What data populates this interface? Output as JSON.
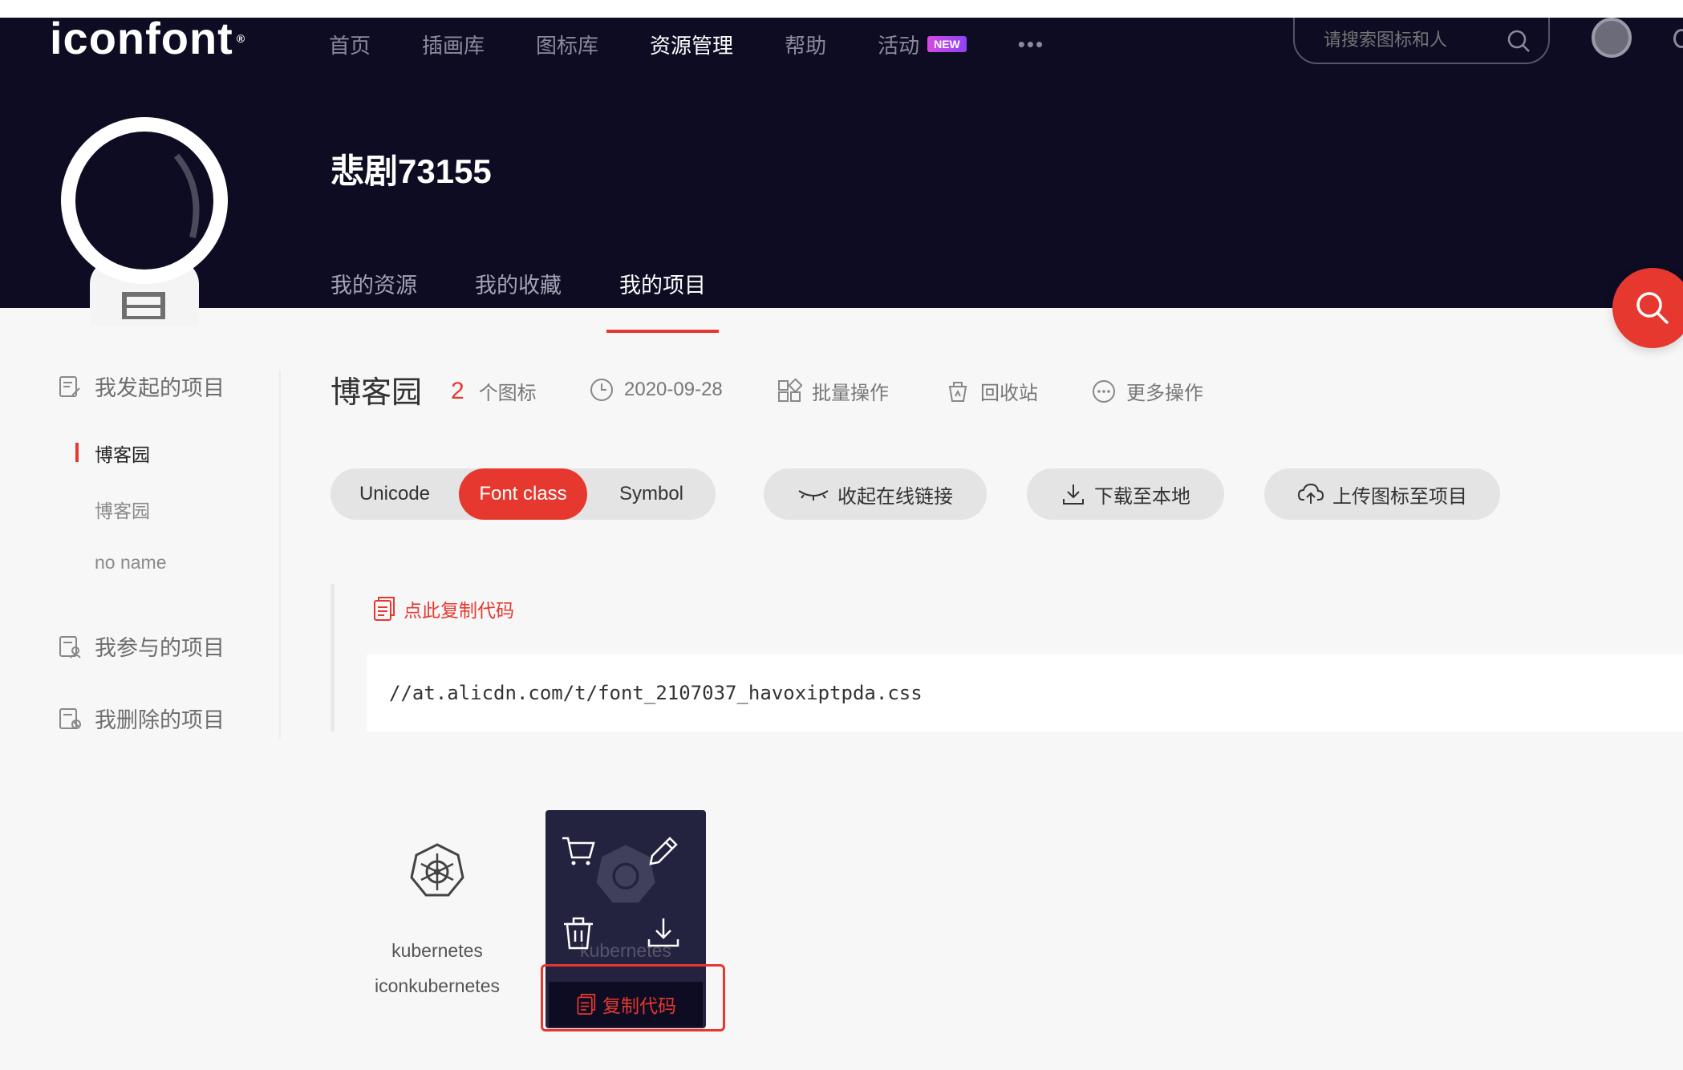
{
  "header": {
    "logo": "iconfont",
    "nav": [
      {
        "label": "首页"
      },
      {
        "label": "插画库"
      },
      {
        "label": "图标库"
      },
      {
        "label": "资源管理",
        "active": true
      },
      {
        "label": "帮助"
      },
      {
        "label": "活动",
        "badge": "NEW"
      }
    ],
    "more": "•••",
    "search_placeholder": "请搜索图标和人"
  },
  "profile": {
    "username": "悲剧73155",
    "tabs": [
      {
        "label": "我的资源"
      },
      {
        "label": "我的收藏"
      },
      {
        "label": "我的项目",
        "active": true
      }
    ]
  },
  "sidebar": {
    "groups": [
      {
        "label": "我发起的项目",
        "icon": "doc-edit-icon"
      },
      {
        "label": "我参与的项目",
        "icon": "doc-user-icon"
      },
      {
        "label": "我删除的项目",
        "icon": "doc-delete-icon"
      }
    ],
    "items": [
      {
        "label": "博客园",
        "active": true
      },
      {
        "label": "博客园"
      },
      {
        "label": "no name"
      }
    ]
  },
  "project": {
    "title": "博客园",
    "icon_count": "2",
    "icon_count_unit": "个图标",
    "date": "2020-09-28",
    "batch": "批量操作",
    "recycle": "回收站",
    "more": "更多操作",
    "format_tabs": [
      {
        "label": "Unicode"
      },
      {
        "label": "Font class",
        "active": true
      },
      {
        "label": "Symbol"
      }
    ],
    "collapse_link": "收起在线链接",
    "download": "下载至本地",
    "upload": "上传图标至项目",
    "copy_code_link": "点此复制代码",
    "css_url": "//at.alicdn.com/t/font_2107037_havoxiptpda.css"
  },
  "icons": [
    {
      "name": "kubernetes",
      "code": "iconkubernetes"
    },
    {
      "name": "kubernetes",
      "copy_label": "复制代码"
    }
  ],
  "colors": {
    "accent": "#e6382f",
    "header_bg": "#0d0c23",
    "card_hover_bg": "#24233f"
  }
}
